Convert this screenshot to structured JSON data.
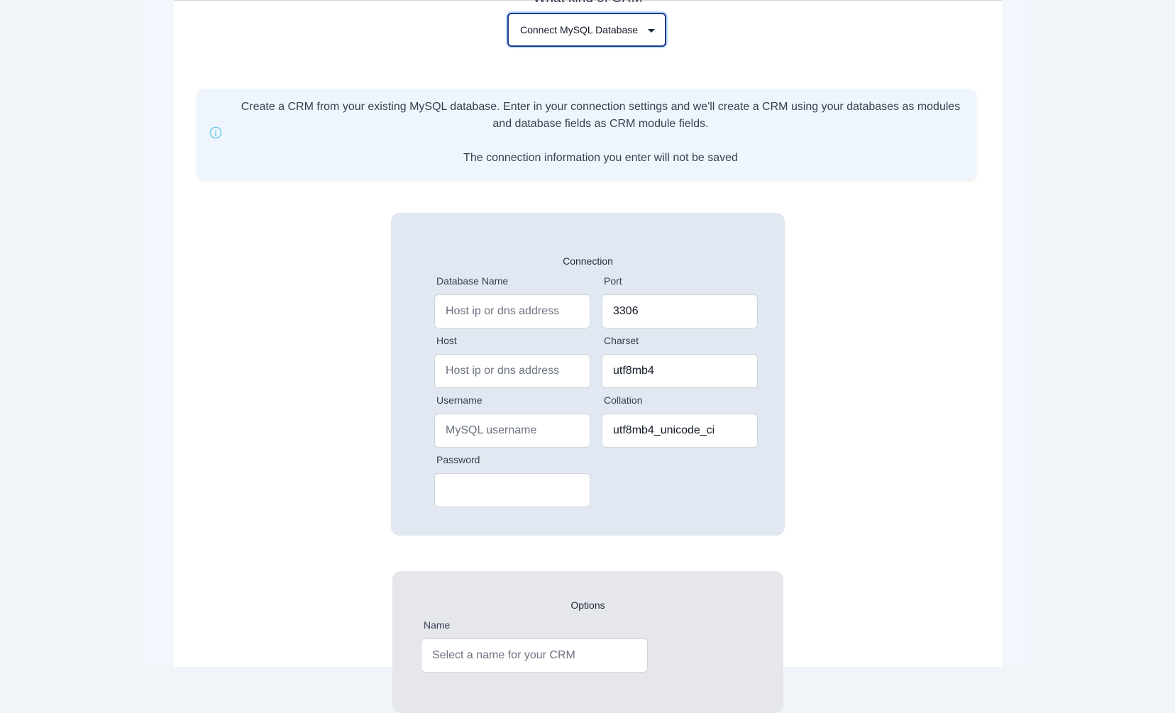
{
  "header": {
    "partial_heading": "What kind of CRM"
  },
  "crm_type_select": {
    "selected": "Connect MySQL Database"
  },
  "info": {
    "line1": "Create a CRM from your existing MySQL database. Enter in your connection settings and we'll create a CRM using your databases as modules",
    "line2": "and database fields as CRM module fields.",
    "line3": "The connection information you enter will not be saved"
  },
  "connection": {
    "title": "Connection",
    "database_name": {
      "label": "Database Name",
      "placeholder": "Host ip or dns address",
      "value": ""
    },
    "port": {
      "label": "Port",
      "value": "3306"
    },
    "host": {
      "label": "Host",
      "placeholder": "Host ip or dns address",
      "value": ""
    },
    "charset": {
      "label": "Charset",
      "value": "utf8mb4"
    },
    "username": {
      "label": "Username",
      "placeholder": "MySQL username",
      "value": ""
    },
    "collation": {
      "label": "Collation",
      "value": "utf8mb4_unicode_ci"
    },
    "password": {
      "label": "Password",
      "value": ""
    }
  },
  "options": {
    "title": "Options",
    "name": {
      "label": "Name",
      "placeholder": "Select a name for your CRM",
      "value": ""
    }
  },
  "colors": {
    "accent": "#1e3a8a",
    "info_icon": "#67c8e6",
    "panel_bg": "#e2e8f1"
  }
}
